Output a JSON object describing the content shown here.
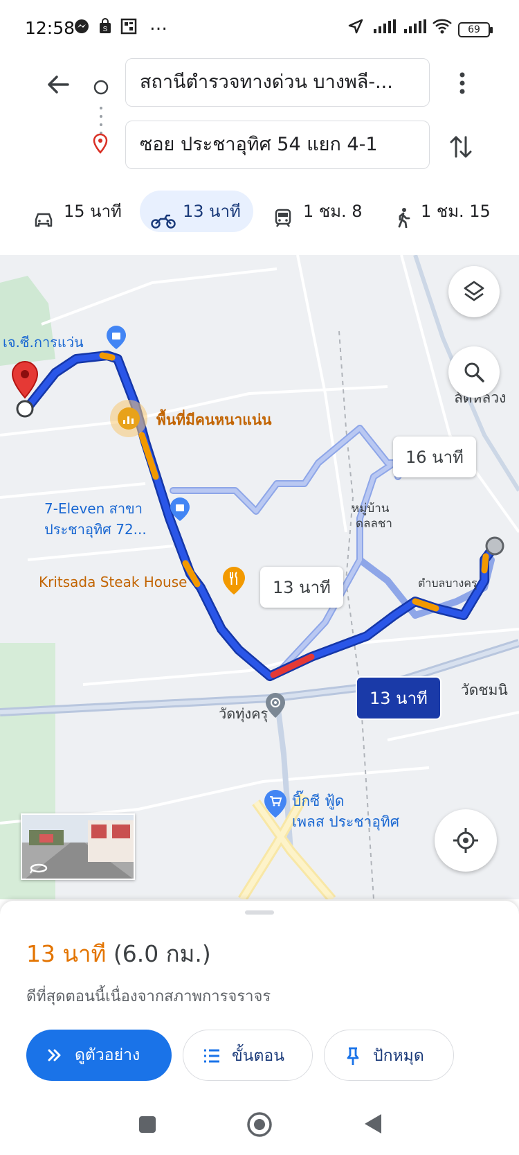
{
  "status_bar": {
    "time": "12:58",
    "notif_icons": [
      "messenger-icon",
      "shopping-bag-icon",
      "qr-icon"
    ],
    "dots": "…",
    "battery": "69"
  },
  "directions": {
    "origin": "สถานีตำรวจทางด่วน บางพลี-...",
    "destination": "ซอย ประชาอุทิศ 54 แยก 4-1"
  },
  "modes": [
    {
      "icon": "car-icon",
      "label": "15 นาที"
    },
    {
      "icon": "motorcycle-icon",
      "label": "13 นาที"
    },
    {
      "icon": "transit-icon",
      "label": "1 ชม. 8"
    },
    {
      "icon": "walk-icon",
      "label": "1 ชม. 15"
    }
  ],
  "map": {
    "labels": {
      "jc_garage": "เจ.ซี.การแว่น",
      "busy_area": "พื้นที่มีคนหนาแน่น",
      "seven_eleven_1": "7-Eleven สาขา",
      "seven_eleven_2": "ประชาอุทิศ 72...",
      "steak_house": "Kritsada Steak House",
      "lat_luang": "ลัดหลวง",
      "village_1": "หมู่บ้าน",
      "village_2": "ดลลชา",
      "tambon": "ตำบลบางครุ",
      "wat_thung_kru": "วัดทุ่งครุ",
      "wat_chom": "วัดชมนิ",
      "bigc_1": "บิ๊กซี ฟู้ด",
      "bigc_2": "เพลส ประชาอุทิศ"
    },
    "route_bubbles": {
      "alt1": "16 นาที",
      "alt2": "13 นาที",
      "selected": "13 นาที"
    }
  },
  "summary": {
    "duration": "13 นาที",
    "distance": "(6.0 กม.)",
    "note": "ดีที่สุดตอนนี้เนื่องจากสภาพการจราจร",
    "buttons": {
      "preview": "ดูตัวอย่าง",
      "steps": "ขั้นตอน",
      "pin": "ปักหมุด"
    }
  },
  "colors": {
    "route_blue": "#2a56e8",
    "traffic_orange": "#f29900",
    "traffic_red": "#e53935",
    "accent": "#1a73e8",
    "duration_orange": "#e37400"
  }
}
